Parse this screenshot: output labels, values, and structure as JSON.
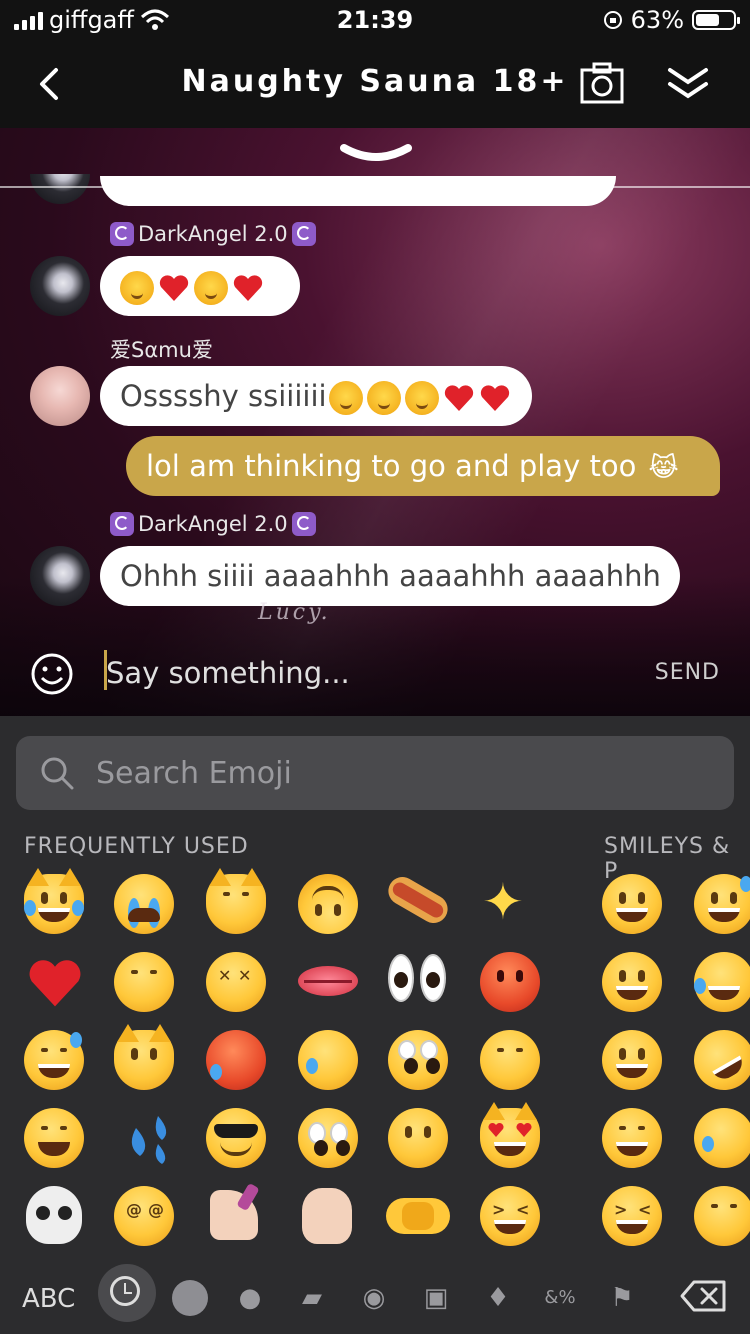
{
  "status": {
    "carrier": "giffgaff",
    "time": "21:39",
    "battery": "63%",
    "battery_level": 0.63
  },
  "header": {
    "title": "Naughty Sauna 18+"
  },
  "messages": {
    "author1": "DarkAngel 2.0",
    "author2": "爱Sαmu爱",
    "author3": "DarkAngel 2.0",
    "msg2_text": "Osssshy ssiiiiii",
    "msg3_text": "lol am thinking to go and play too",
    "msg4_text": "Ohhh siiii aaaahhh aaaahhh aaaahhh",
    "watermark": "Lucy."
  },
  "composer": {
    "placeholder": "Say something...",
    "send_label": "SEND"
  },
  "emoji_keyboard": {
    "search_placeholder": "Search Emoji",
    "section_frequent": "FREQUENTLY USED",
    "section_smileys": "SMILEYS & P",
    "abc_label": "ABC"
  },
  "colors": {
    "accent": "#c9a64a",
    "header_bg": "#121212",
    "keyboard_bg": "#2c2c2e"
  }
}
